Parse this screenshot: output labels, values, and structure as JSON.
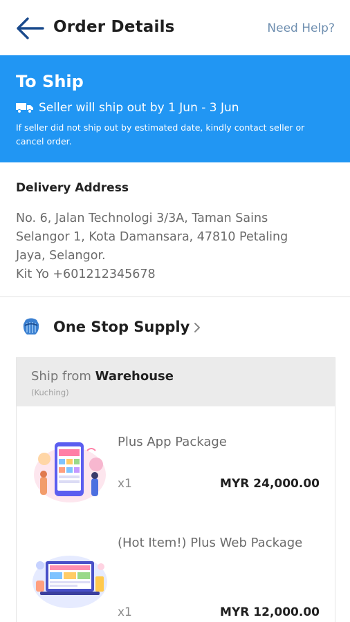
{
  "header": {
    "title": "Order Details",
    "help_label": "Need Help?"
  },
  "status": {
    "title": "To Ship",
    "ship_text": "Seller will ship out by 1 Jun - 3 Jun",
    "note": "If seller did not ship out by estimated date, kindly contact seller or cancel order."
  },
  "address": {
    "heading": "Delivery Address",
    "line1": "No. 6, Jalan Technologi 3/3A, Taman Sains",
    "line2": "Selangor 1, Kota Damansara, 47810 Petaling",
    "line3": "Jaya, Selangor.",
    "line4": "Kit Yo +601212345678"
  },
  "shop": {
    "name": "One Stop Supply"
  },
  "shipment": {
    "ship_from_label": "Ship from",
    "warehouse": "Warehouse",
    "location": "(Kuching)"
  },
  "items": [
    {
      "name": "Plus App Package",
      "qty": "x1",
      "price": "MYR 24,000.00"
    },
    {
      "name": "(Hot Item!) Plus Web Package",
      "qty": "x1",
      "price": "MYR 12,000.00"
    }
  ],
  "colors": {
    "banner": "#2196f3",
    "back_arrow": "#1a4a8c",
    "help_link": "#6f8fb0"
  },
  "icons": {
    "back": "arrow-left-icon",
    "truck": "truck-icon",
    "shop": "shop-logo-icon",
    "chevron": "chevron-right-icon"
  }
}
